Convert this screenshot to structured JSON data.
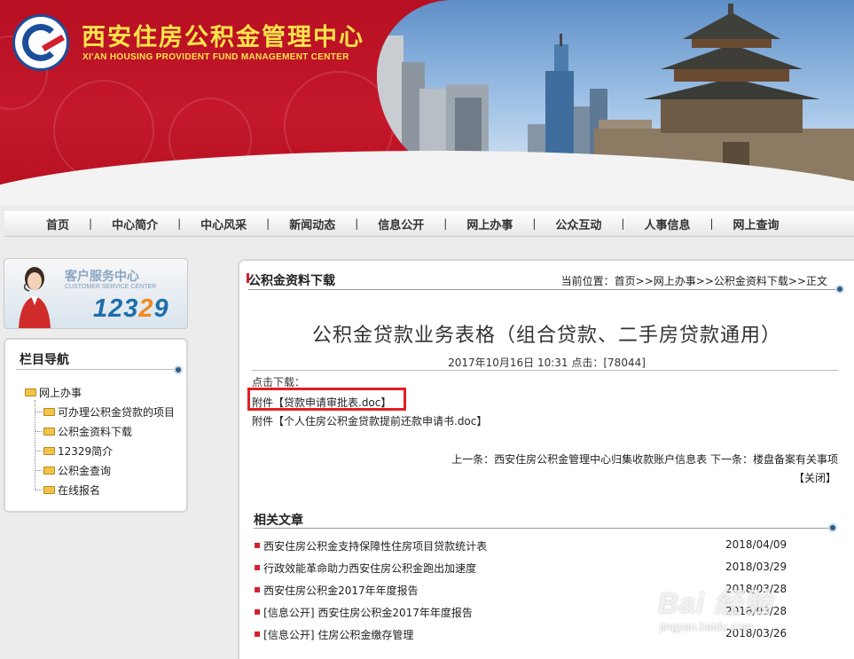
{
  "header": {
    "title": "西安住房公积金管理中心",
    "subtitle": "XI'AN HOUSING PROVIDENT FUND MANAGEMENT CENTER",
    "colors": {
      "banner": "#c4182b",
      "title": "#ffe34a",
      "logo_blue": "#1b4e9b"
    }
  },
  "nav": {
    "items": [
      "首页",
      "中心简介",
      "中心风采",
      "新闻动态",
      "信息公开",
      "网上办事",
      "公众互动",
      "人事信息",
      "网上查询"
    ],
    "separator": "|"
  },
  "service_banner": {
    "title": "客户服务中心",
    "subtitle": "CUSTOMER SERVICE CENTER",
    "hotline_main": "123",
    "hotline_accent": "2",
    "hotline_tail": "9"
  },
  "sidebar": {
    "heading": "栏目导航",
    "root": "网上办事",
    "items": [
      "可办理公积金贷款的项目",
      "公积金资料下载",
      "12329简介",
      "公积金查询",
      "在线报名"
    ]
  },
  "content": {
    "section_title": "公积金资料下载",
    "breadcrumb": "当前位置：首页>>网上办事>>公积金资料下载>>正文",
    "article_title": "公积金贷款业务表格（组合贷款、二手房贷款通用）",
    "meta": "2017年10月16日 10:31 点击：[78044]",
    "download_label": "点击下载：",
    "attachments": [
      "附件【贷款申请审批表.doc】",
      "附件【个人住房公积金贷款提前还款申请书.doc】"
    ],
    "prev_next": "上一条：西安住房公积金管理中心归集收款账户信息表 下一条：楼盘备案有关事项",
    "close_label": "【关闭】",
    "highlight_color": "#e32020"
  },
  "related": {
    "heading": "相关文章",
    "items": [
      {
        "title": "西安住房公积金支持保障性住房项目贷款统计表",
        "date": "2018/04/09"
      },
      {
        "title": "行政效能革命助力西安住房公积金跑出加速度",
        "date": "2018/03/29"
      },
      {
        "title": "西安住房公积金2017年年度报告",
        "date": "2018/03/28"
      },
      {
        "title": "[信息公开] 西安住房公积金2017年年度报告",
        "date": "2018/03/28"
      },
      {
        "title": "[信息公开] 住房公积金缴存管理",
        "date": "2018/03/26"
      }
    ]
  },
  "watermark": {
    "brand": "Bai 经验",
    "url": "jingyan.baidu.com"
  }
}
